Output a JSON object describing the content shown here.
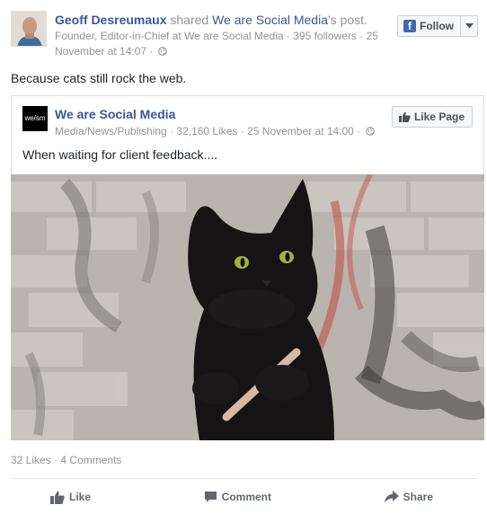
{
  "post": {
    "author": "Geoff Desreumaux",
    "shared_word": "shared",
    "shared_page": "We are Social Media",
    "shared_suffix": "'s post.",
    "subline": "Founder, Editor-in-Chief at We are Social Media · 395 followers · 25 November at 14:07 ·",
    "text": "Because cats still rock the web.",
    "follow_label": "Follow"
  },
  "shared": {
    "page_name": "We are Social Media",
    "page_logo_text": "we/sm",
    "page_info": "Media/News/Publishing · 32,160 Likes · 25 November at 14:00 ·",
    "like_page_label": "Like Page",
    "text": "When waiting for client feedback...."
  },
  "footer": {
    "likes": "32 Likes",
    "separator": " · ",
    "comments": "4 Comments",
    "like_label": "Like",
    "comment_label": "Comment",
    "share_label": "Share"
  },
  "icons": [
    "globe-icon",
    "facebook-icon",
    "chevron-down-icon",
    "thumbs-up-icon",
    "comment-icon",
    "share-icon"
  ],
  "colors": {
    "link": "#365899",
    "meta": "#90949c",
    "facebook_blue": "#4267b2"
  }
}
